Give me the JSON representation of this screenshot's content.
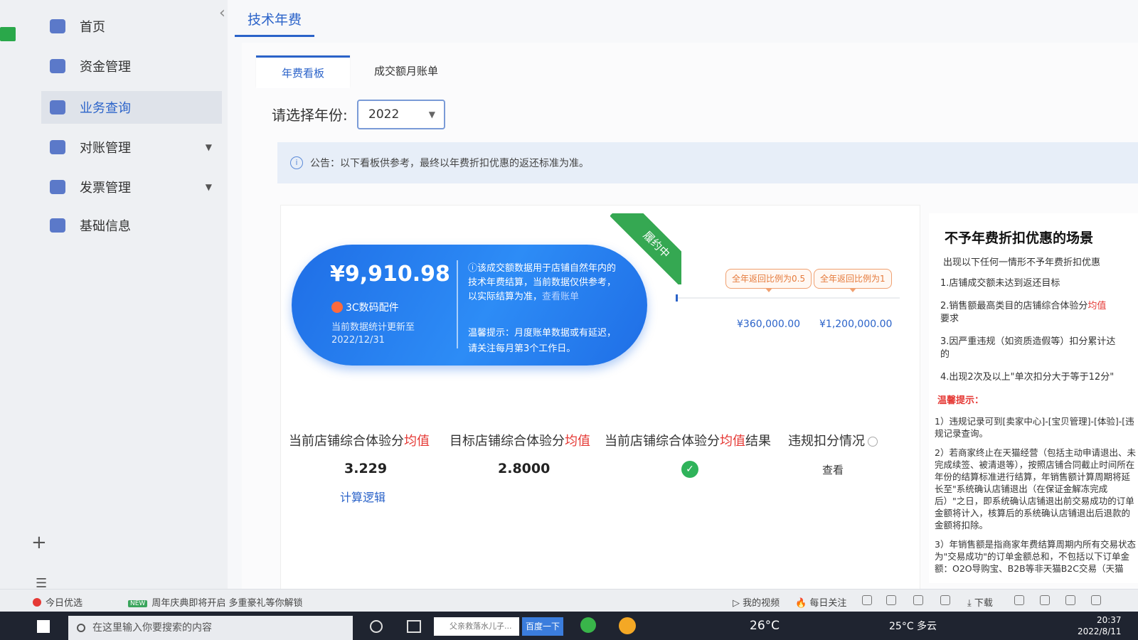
{
  "sidebar": {
    "items": [
      {
        "label": "首页"
      },
      {
        "label": "资金管理"
      },
      {
        "label": "业务查询"
      },
      {
        "label": "对账管理"
      },
      {
        "label": "发票管理"
      },
      {
        "label": "基础信息"
      }
    ]
  },
  "header": {
    "tab": "技术年费"
  },
  "subtabs": [
    "年费看板",
    "成交额月账单"
  ],
  "year_select": {
    "label": "请选择年份:",
    "value": "2022"
  },
  "notice": "公告：以下看板供参考，最终以年费折扣优惠的返还标准为准。",
  "ribbon": "履约中",
  "summary": {
    "amount": "¥9,910.98",
    "category": "3C数码配件",
    "update_line1": "当前数据统计更新至",
    "update_date": "2022/12/31",
    "desc": "该成交额数据用于店铺自然年内的技术年费结算，当前数据仅供参考，以实际结算为准，",
    "desc_link": "查看账单",
    "tip": "温馨提示：月度账单数据或有延迟，请关注每月第3个工作日。"
  },
  "progress": {
    "tag1": "全年返回比例为0.5",
    "tag2": "全年返回比例为1",
    "amount1": "¥360,000.00",
    "amount2": "¥1,200,000.00"
  },
  "metrics": {
    "col1_head_a": "当前店铺综合体验分",
    "col1_head_b": "均值",
    "col1_value": "3.229",
    "col1_link": "计算逻辑",
    "col2_head_a": "目标店铺综合体验分",
    "col2_head_b": "均值",
    "col2_value": "2.8000",
    "col3_head_a": "当前店铺综合体验分",
    "col3_head_b": "均值",
    "col3_head_c": "结果",
    "col4_head": "违规扣分情况",
    "col4_link": "查看"
  },
  "rules": {
    "title": "不予年费折扣优惠的场景",
    "intro": "出现以下任何一情形不予年费折扣优惠",
    "items": [
      {
        "a": "1.店铺成交额未达到返还目标",
        "b": "",
        "c": ""
      },
      {
        "a": "2.销售额最高类目的店铺综合体验分",
        "b": "均值",
        "c": "要求"
      },
      {
        "a": "3.因严重违规（如资质造假等）扣分累计达",
        "b": "",
        "c": "的"
      },
      {
        "a": "4.出现2次及以上\"单次扣分大于等于12分\"",
        "b": "",
        "c": ""
      }
    ],
    "warn_title": "温馨提示：",
    "warn": [
      "1）违规记录可到[卖家中心]-[宝贝管理]-[体验]-[违规记录查询。",
      "2）若商家终止在天猫经营（包括主动申请退出、未完成续签、被清退等），按照店铺合同截止时间所在年份的结算标准进行结算，年销售额计算周期将延长至\"系统确认店铺退出（在保证金解冻完成后）\"之日，即系统确认店铺退出前交易成功的订单金额将计入，核算后的系统确认店铺退出后退款的金额将扣除。",
      "3）年销售额是指商家年费结算周期内所有交易状态为\"交易成功\"的订单金额总和，不包括以下订单金额：O2O导购宝、B2B等非天猫B2C交易（天猫"
    ]
  },
  "statusbar": {
    "left1": "今日优选",
    "new_badge": "NEW",
    "left2": "周年庆典即将开启 多重豪礼等你解锁",
    "video": "我的视频",
    "follow": "每日关注",
    "download": "下载"
  },
  "taskbar": {
    "search_placeholder": "在这里输入你要搜索的内容",
    "browser_search": "父亲救落水儿子...",
    "browser_btn": "百度一下",
    "weather1": "26°C",
    "weather2": "25°C 多云",
    "time": "20:37",
    "date": "2022/8/11"
  }
}
